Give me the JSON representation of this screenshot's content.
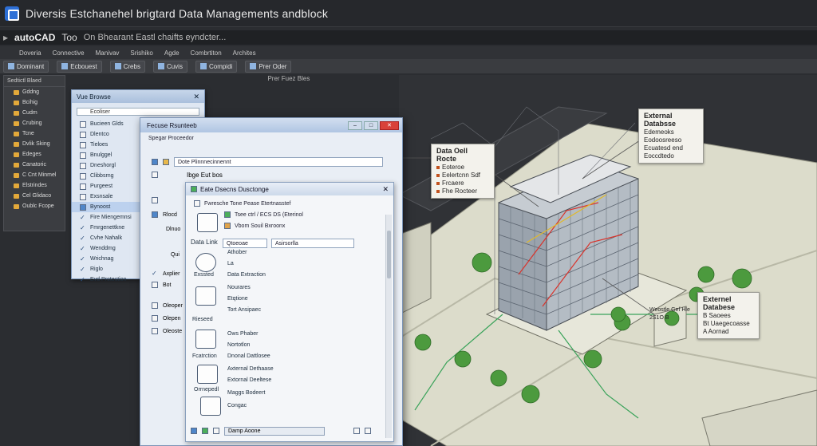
{
  "window": {
    "title": "Diversis Estchanehel brigtard Data Managements andblock"
  },
  "menubar": {
    "brand": "autoCAD",
    "item1": "Too",
    "subtitle": "On Bhearant Eastl chaifts eyndcter..."
  },
  "ribbon": {
    "tabs": [
      "Doveria",
      "Connective",
      "Manivav",
      "Srishiko",
      "Agde",
      "Combrtiton",
      "Archites"
    ],
    "tools": {
      "t1": "Dominant",
      "t2": "Ecbouest",
      "t3": "Crebs",
      "t4": "Cuvis",
      "t5": "Compidi",
      "t6": "Prer Oder",
      "sub": "Prer Fuez Bles"
    }
  },
  "left_panel": {
    "header": "Sedtictl Blaed",
    "items": [
      "Gddng",
      "Bcihig",
      "Cudm",
      "Crubing",
      "Tcne",
      "Dvlik Sking",
      "Edeges",
      "Canatoric",
      "C Cnt Minmel",
      "Elstrindes",
      "Cel Glidaco",
      "Oublc Fcope"
    ]
  },
  "vue": {
    "title": "Vue Browse",
    "search": "Ecoliser",
    "items": [
      "Bucieen Glds",
      "Dlentco",
      "Tieloes",
      "Bnulggel",
      "Dneshorgl",
      "Clibbsrng",
      "Purgeest",
      "Exsnsale",
      "Bynoost",
      "Fire Miengemnsi",
      "Fmrgenettkne",
      "Cvhe Nahalk",
      "Wenddmg",
      "Wrichnag",
      "Riglo",
      "Evd Protection"
    ]
  },
  "feature": {
    "title": "Fecuse Rsunteeb",
    "sub": "Spegar Proceedor",
    "dropdown": "Dote Plinnnecinnennt",
    "tab": "Ibge Eut bos",
    "left_labels": [
      "Rlocd",
      "Dlnuo",
      "Qui"
    ],
    "buttons": [
      "Axplier",
      "Bot"
    ],
    "bottom": [
      "Oleoper",
      "Olepen",
      "Oleoste"
    ]
  },
  "data_dialog": {
    "title": "Eate Dsecns Dusctonge",
    "sub": "Fwresche Tone Pease Etertnasstef",
    "list": [
      "Tsee ctrl / ECS DS (Eterinol",
      "Vbom Souil Bxroonx"
    ],
    "data_link": "Data Link",
    "field1": "Qtoeoae",
    "field2": "Asirsorlla",
    "section1": [
      "Exssted",
      "Rieseed",
      "Fcatrction",
      "Orrnepedl"
    ],
    "opts1": [
      "Athober",
      "La",
      "Data Extraction",
      "Nourares",
      "Etqtione",
      "Tort Ansipaec"
    ],
    "opts2": [
      "Ows Phaber",
      "Nortotlon",
      "Dnonal Dattlosee",
      "Axternal Dethaase",
      "Extornal Deeltese",
      "Maggs Bodeert",
      "Congac"
    ],
    "status": "Damp Aoone"
  },
  "callouts": {
    "c1": {
      "title": "External Databsse",
      "lines": [
        "Edemeoks",
        "Eodoosreeso",
        "Ecuatesd end Eoccdtedo"
      ]
    },
    "c2": {
      "title": "Data Oell Rocte",
      "lines": [
        "Eoteroe",
        "Eelertcnn Sdf",
        "Frcaere",
        "Fhe Rocteer"
      ]
    },
    "c3": {
      "title": "Externel Databese",
      "lines": [
        "B Saoees",
        "Bt Uaegecoasse",
        "A Aornad"
      ]
    },
    "c4": {
      "lines": [
        "Weostle Gef Hle",
        "2S1O B"
      ]
    }
  },
  "colors": {
    "accent": "#2d6fd6",
    "background": "#2b2d31",
    "ground": "#dcdccb"
  }
}
